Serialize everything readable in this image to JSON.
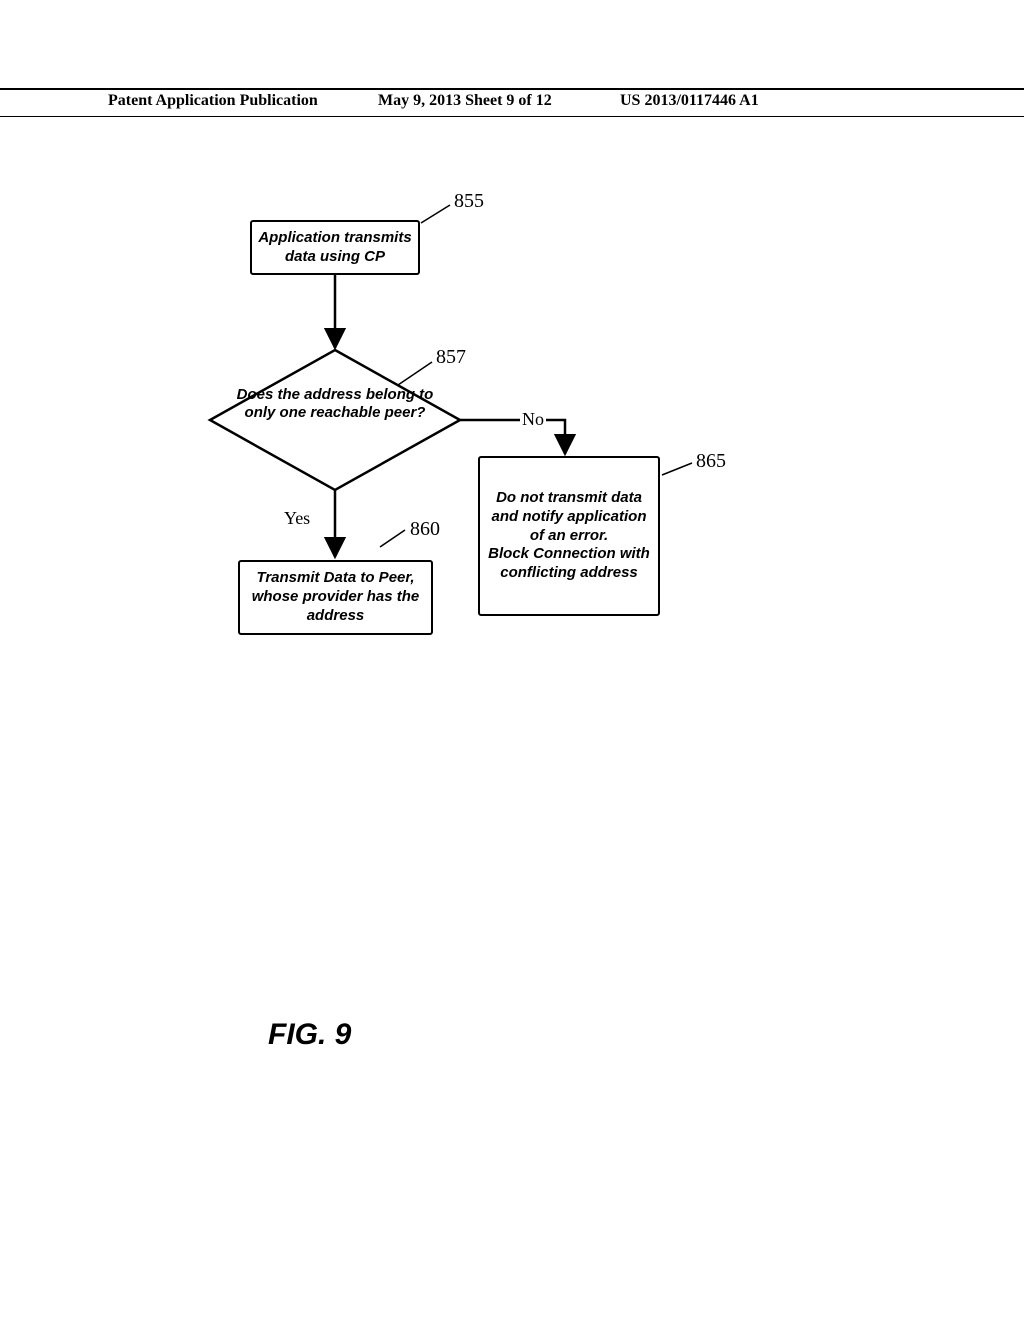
{
  "header": {
    "left": "Patent Application Publication",
    "mid": "May 9, 2013  Sheet 9 of 12",
    "right": "US 2013/0117446 A1"
  },
  "nodes": {
    "n855": "Application transmits data using CP",
    "n857": "Does the address belong to only one reachable peer?",
    "n860": "Transmit Data to Peer, whose provider has the address",
    "n865": "Do not transmit data and notify application of an error.\nBlock Connection with conflicting address"
  },
  "refs": {
    "r855": "855",
    "r857": "857",
    "r860": "860",
    "r865": "865"
  },
  "edges": {
    "yes": "Yes",
    "no": "No"
  },
  "figure": "FIG. 9"
}
